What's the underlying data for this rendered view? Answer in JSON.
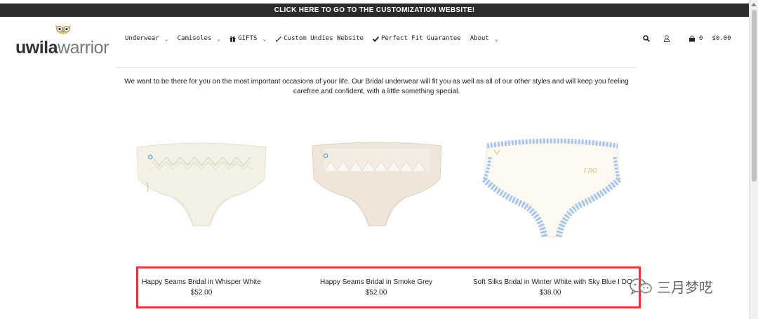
{
  "banner": {
    "text": "CLICK HERE TO GO TO THE CUSTOMIZATION WEBSITE!"
  },
  "logo": {
    "text_bold": "uwila",
    "text_light": "warrior"
  },
  "nav": {
    "items": [
      {
        "label": "Underwear",
        "icon": "",
        "has_dropdown": true
      },
      {
        "label": "Camisoles",
        "icon": "",
        "has_dropdown": true
      },
      {
        "label": "GIFTS",
        "icon": "gift-icon",
        "has_dropdown": true
      },
      {
        "label": "Custom Undies Website",
        "icon": "brush-icon",
        "has_dropdown": false
      },
      {
        "label": "Perfect Fit Guarantee",
        "icon": "check-icon",
        "has_dropdown": false
      },
      {
        "label": "About",
        "icon": "",
        "has_dropdown": true
      }
    ]
  },
  "header": {
    "cart_count": "0",
    "cart_total": "$0.00"
  },
  "intro": {
    "text": "We want to be there for you on the most important occasions of your life. Our Bridal underwear will fit you as well as all of our other styles and will keep you feeling carefree and confident, with a little something special."
  },
  "products": [
    {
      "name": "Happy Seams Bridal in Whisper White",
      "price": "$52.00",
      "color": "#f3f1e6"
    },
    {
      "name": "Happy Seams Bridal in Smoke Grey",
      "price": "$52.00",
      "color": "#eee6da"
    },
    {
      "name": "Soft Silks Bridal in Winter White with Sky Blue I DO",
      "price": "$38.00",
      "color": "#fbf9f2"
    }
  ],
  "watermark": {
    "text": "三月梦呓"
  }
}
